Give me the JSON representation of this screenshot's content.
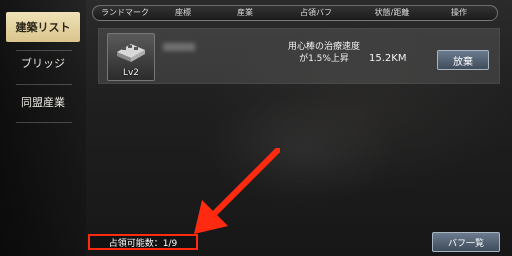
{
  "sidebar": {
    "items": [
      {
        "label": "建築リスト",
        "active": true
      },
      {
        "label": "ブリッジ",
        "active": false
      },
      {
        "label": "同盟産業",
        "active": false
      }
    ]
  },
  "header": {
    "columns": [
      "ランドマーク",
      "座標",
      "産業",
      "占領バフ",
      "状態/距離",
      "操作"
    ]
  },
  "building": {
    "level": "Lv2",
    "effect_line1": "用心棒の治療速度",
    "effect_line2": "が1.5%上昇",
    "distance": "15.2KM",
    "action_label": "放棄"
  },
  "footer": {
    "occupy_count": "占領可能数：1/9",
    "buff_list_label": "バフ一覧"
  },
  "colors": {
    "active_tab": "#e6d59f",
    "button": "#55657a",
    "highlight": "#ff2a10"
  }
}
